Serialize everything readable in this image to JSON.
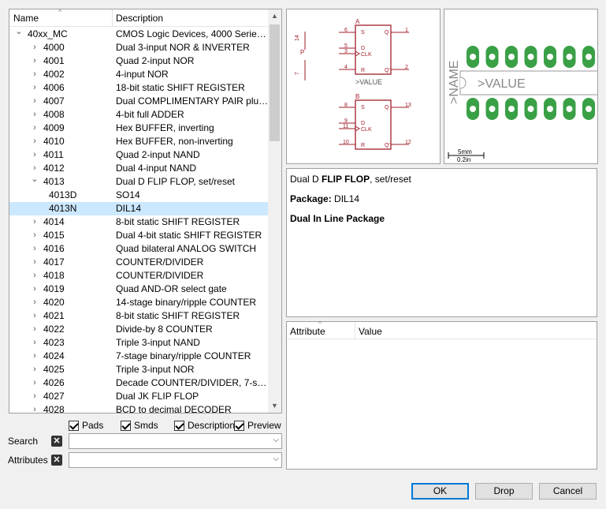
{
  "tree": {
    "columns": {
      "name": "Name",
      "description": "Description"
    },
    "rows": [
      {
        "name": "40xx_MC",
        "desc": "CMOS Logic Devices, 4000 Series (...",
        "level": 0,
        "arrow": "⌄"
      },
      {
        "name": "4000",
        "desc": "Dual 3-input NOR & INVERTER",
        "level": 1,
        "arrow": "›"
      },
      {
        "name": "4001",
        "desc": "Quad 2-input NOR",
        "level": 1,
        "arrow": "›"
      },
      {
        "name": "4002",
        "desc": "4-input NOR",
        "level": 1,
        "arrow": "›"
      },
      {
        "name": "4006",
        "desc": "18-bit static SHIFT REGISTER",
        "level": 1,
        "arrow": "›"
      },
      {
        "name": "4007",
        "desc": "Dual COMPLIMENTARY PAIR plus...",
        "level": 1,
        "arrow": "›"
      },
      {
        "name": "4008",
        "desc": "4-bit full ADDER",
        "level": 1,
        "arrow": "›"
      },
      {
        "name": "4009",
        "desc": "Hex BUFFER, inverting",
        "level": 1,
        "arrow": "›"
      },
      {
        "name": "4010",
        "desc": "Hex BUFFER, non-inverting",
        "level": 1,
        "arrow": "›"
      },
      {
        "name": "4011",
        "desc": "Quad 2-input NAND",
        "level": 1,
        "arrow": "›"
      },
      {
        "name": "4012",
        "desc": "Dual 4-input NAND",
        "level": 1,
        "arrow": "›"
      },
      {
        "name": "4013",
        "desc": "Dual D FLIP FLOP, set/reset",
        "level": 1,
        "arrow": "⌄"
      },
      {
        "name": "4013D",
        "desc": "SO14",
        "level": 2,
        "arrow": ""
      },
      {
        "name": "4013N",
        "desc": "DIL14",
        "level": 2,
        "arrow": "",
        "selected": true
      },
      {
        "name": "4014",
        "desc": "8-bit static SHIFT REGISTER",
        "level": 1,
        "arrow": "›"
      },
      {
        "name": "4015",
        "desc": "Dual 4-bit static SHIFT REGISTER",
        "level": 1,
        "arrow": "›"
      },
      {
        "name": "4016",
        "desc": "Quad bilateral ANALOG SWITCH",
        "level": 1,
        "arrow": "›"
      },
      {
        "name": "4017",
        "desc": "COUNTER/DIVIDER",
        "level": 1,
        "arrow": "›"
      },
      {
        "name": "4018",
        "desc": "COUNTER/DIVIDER",
        "level": 1,
        "arrow": "›"
      },
      {
        "name": "4019",
        "desc": "Quad AND-OR select gate",
        "level": 1,
        "arrow": "›"
      },
      {
        "name": "4020",
        "desc": "14-stage binary/ripple COUNTER",
        "level": 1,
        "arrow": "›"
      },
      {
        "name": "4021",
        "desc": "8-bit static SHIFT REGISTER",
        "level": 1,
        "arrow": "›"
      },
      {
        "name": "4022",
        "desc": "Divide-by 8 COUNTER",
        "level": 1,
        "arrow": "›"
      },
      {
        "name": "4023",
        "desc": "Triple 3-input NAND",
        "level": 1,
        "arrow": "›"
      },
      {
        "name": "4024",
        "desc": "7-stage binary/ripple COUNTER",
        "level": 1,
        "arrow": "›"
      },
      {
        "name": "4025",
        "desc": "Triple 3-input NOR",
        "level": 1,
        "arrow": "›"
      },
      {
        "name": "4026",
        "desc": "Decade COUNTER/DIVIDER, 7-seg....",
        "level": 1,
        "arrow": "›"
      },
      {
        "name": "4027",
        "desc": "Dual JK FLIP FLOP",
        "level": 1,
        "arrow": "›"
      },
      {
        "name": "4028",
        "desc": "BCD to decimal DECODER",
        "level": 1,
        "arrow": "›"
      }
    ]
  },
  "filters": {
    "pads": "Pads",
    "smds": "Smds",
    "description": "Description",
    "preview": "Preview"
  },
  "search": {
    "label": "Search",
    "value": ""
  },
  "attributes_filter": {
    "label": "Attributes",
    "value": ""
  },
  "symbol": {
    "gate_a": "A",
    "gate_b": "B",
    "value_label": ">VALUE",
    "pin_s": "S",
    "pin_d": "D",
    "pin_clk": "CLK",
    "pin_r": "R",
    "pin_q": "Q",
    "pin_qn": "Q'",
    "power_p": "P",
    "power_vdd": "VDD",
    "power_vss": "VSS",
    "power_14": "14",
    "power_7": "7",
    "a_pins": [
      "6",
      "5",
      "3",
      "4",
      "1",
      "2"
    ],
    "b_pins": [
      "8",
      "9",
      "11",
      "10",
      "13",
      "12"
    ]
  },
  "package": {
    "name_label": ">NAME",
    "value_label": ">VALUE",
    "scale_mm": "5mm",
    "scale_in": "0.2in"
  },
  "description": {
    "line1_prefix": "Dual D ",
    "line1_bold": "FLIP FLOP",
    "line1_suffix": ", set/reset",
    "package_label": "Package:",
    "package_value": " DIL14",
    "package_desc": "Dual In Line Package"
  },
  "attributes": {
    "col_attribute": "Attribute",
    "col_value": "Value"
  },
  "buttons": {
    "ok": "OK",
    "drop": "Drop",
    "cancel": "Cancel"
  },
  "colors": {
    "selection": "#cce8ff",
    "symbol": "#a01e2a",
    "pad": "#3aa046",
    "accent": "#0078d7"
  }
}
